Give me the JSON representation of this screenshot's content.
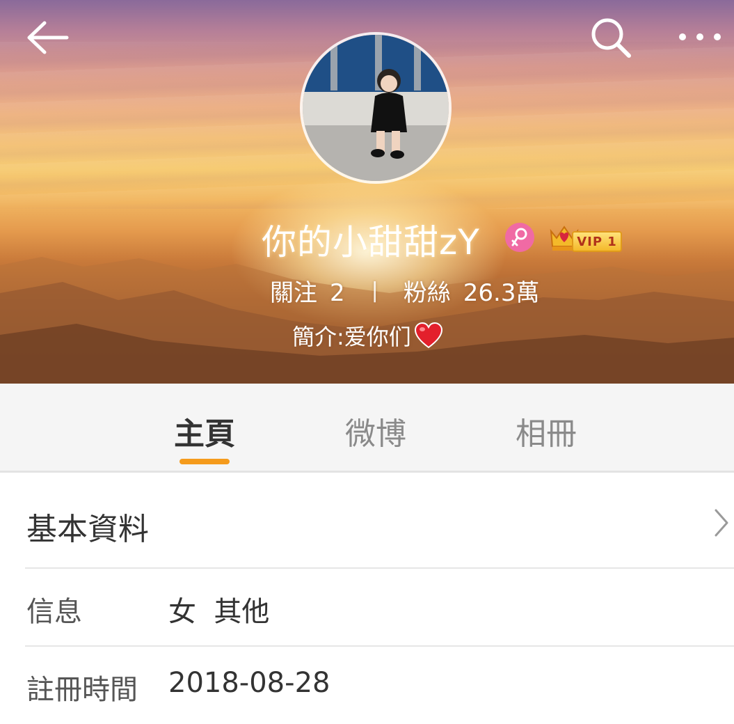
{
  "header": {
    "back_icon": "back-arrow-icon",
    "search_icon": "search-icon",
    "more_icon": "more-dots-icon"
  },
  "profile": {
    "username": "你的小甜甜zY",
    "gender_icon": "female-icon",
    "vip_label": "VIP 1",
    "following_label": "關注",
    "following_count": "2",
    "stat_separator": "|",
    "followers_label": "粉絲",
    "followers_count": "26.3萬",
    "bio": "簡介:爱你们",
    "colors": {
      "gender_badge": "#f06aa4",
      "vip_gold": "#f4b92a"
    }
  },
  "tabs": [
    {
      "label": "主頁",
      "active": true
    },
    {
      "label": "微博",
      "active": false
    },
    {
      "label": "相冊",
      "active": false
    }
  ],
  "tab_indicator_color": "#f59b1c",
  "basic_info": {
    "title": "基本資料",
    "rows": [
      {
        "label": "信息",
        "value": "女  其他"
      },
      {
        "label": "註冊時間",
        "value": "2018-08-28"
      }
    ]
  }
}
